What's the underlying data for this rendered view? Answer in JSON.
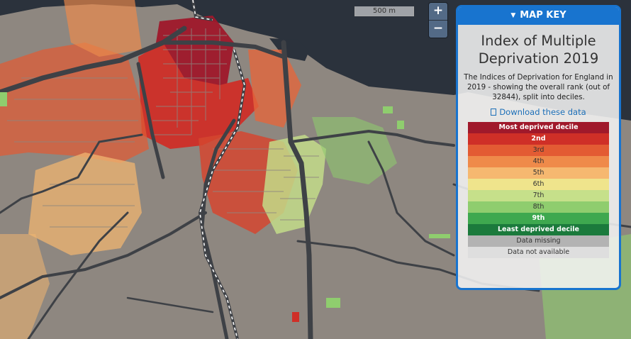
{
  "scale_bar": {
    "label": "500 m"
  },
  "zoom": {
    "in_label": "+",
    "out_label": "−"
  },
  "map_key": {
    "header": "MAP KEY",
    "title": "Index of Multiple Deprivation 2019",
    "description": "The Indices of Deprivation for England in 2019 - showing the overall rank (out of 32844), split into deciles.",
    "download_label": "Download these data",
    "legend": [
      {
        "label": "Most deprived decile",
        "color": "#a0192b",
        "text_color": "#ffffff",
        "bold": true
      },
      {
        "label": "2nd",
        "color": "#cf2f27",
        "text_color": "#ffffff",
        "bold": true
      },
      {
        "label": "3rd",
        "color": "#e35b33",
        "text_color": "#333333",
        "bold": false
      },
      {
        "label": "4th",
        "color": "#ef8a4a",
        "text_color": "#333333",
        "bold": false
      },
      {
        "label": "5th",
        "color": "#f6b870",
        "text_color": "#333333",
        "bold": false
      },
      {
        "label": "6th",
        "color": "#efe48c",
        "text_color": "#333333",
        "bold": false
      },
      {
        "label": "7th",
        "color": "#c6e08a",
        "text_color": "#333333",
        "bold": false
      },
      {
        "label": "8th",
        "color": "#8fcd6e",
        "text_color": "#333333",
        "bold": false
      },
      {
        "label": "9th",
        "color": "#3ea84f",
        "text_color": "#ffffff",
        "bold": true
      },
      {
        "label": "Least deprived decile",
        "color": "#1b7a3c",
        "text_color": "#ffffff",
        "bold": true
      },
      {
        "label": "Data missing",
        "color": "#b3b3b3",
        "text_color": "#333333",
        "bold": false
      },
      {
        "label": "Data not available",
        "color": "#dedede",
        "text_color": "#333333",
        "bold": false
      }
    ]
  },
  "colors": {
    "sea": "#2b323c",
    "land": "#8e8780",
    "roads": "#3e4146",
    "accent": "#1874cf"
  }
}
